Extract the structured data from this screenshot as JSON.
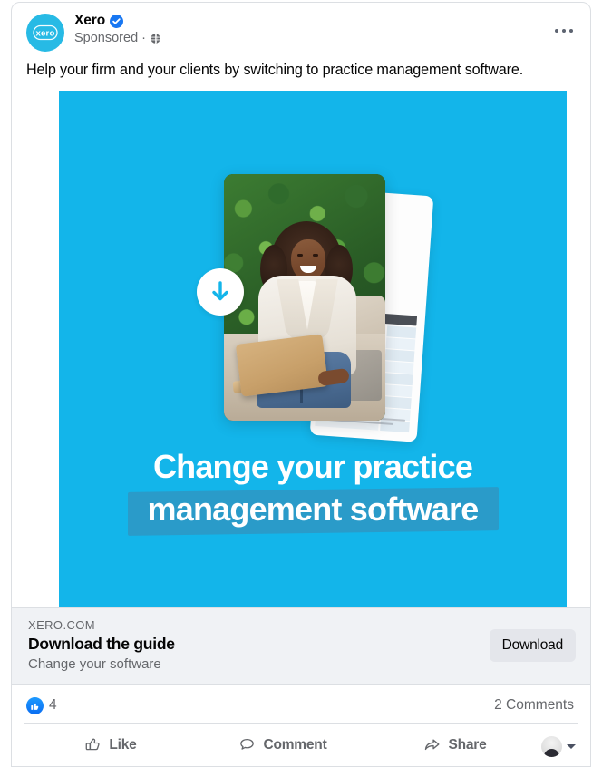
{
  "post": {
    "page_name": "Xero",
    "verified": true,
    "verified_icon": "verified-badge-icon",
    "sponsored_label": "Sponsored",
    "separator": "·",
    "audience_icon": "globe-icon",
    "options_icon": "ellipsis-icon",
    "message": "Help your firm and your clients by switching to practice management software."
  },
  "brand": {
    "logo_text": "xero",
    "logo_bg": "#27bae5",
    "creative_bg": "#13b5ea",
    "highlight_band": "#2a9bc9"
  },
  "creative": {
    "headline_line1": "Change your practice",
    "headline_line2": "management software",
    "download_icon": "download-arrow-icon",
    "photo_alt_name": "woman-with-laptop-photo",
    "document_alt_name": "guide-document-preview"
  },
  "link_preview": {
    "domain": "XERO.COM",
    "title": "Download the guide",
    "description": "Change your software",
    "cta_label": "Download"
  },
  "engagement": {
    "reaction_icon": "like-reaction-icon",
    "reaction_count": "4",
    "comments_count": "2 Comments"
  },
  "actions": [
    {
      "label": "Like",
      "icon": "thumbs-up-icon"
    },
    {
      "label": "Comment",
      "icon": "comment-bubble-icon"
    },
    {
      "label": "Share",
      "icon": "share-arrow-icon"
    }
  ],
  "profile_switcher": {
    "avatar_icon": "user-avatar-icon",
    "caret_icon": "chevron-down-icon"
  }
}
